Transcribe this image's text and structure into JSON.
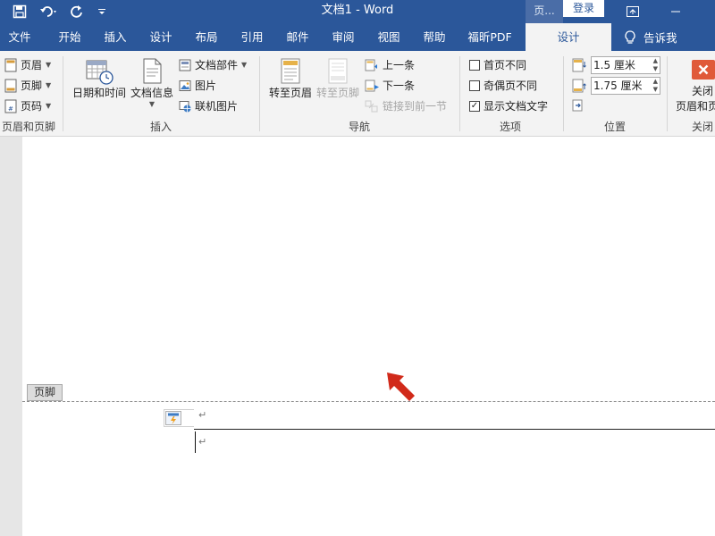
{
  "titlebar": {
    "doc_title": "文档1  -  Word",
    "context_tab_label": "页...",
    "login_label": "登录"
  },
  "tabs": [
    {
      "label": "文件"
    },
    {
      "label": "开始"
    },
    {
      "label": "插入"
    },
    {
      "label": "设计"
    },
    {
      "label": "布局"
    },
    {
      "label": "引用"
    },
    {
      "label": "邮件"
    },
    {
      "label": "审阅"
    },
    {
      "label": "视图"
    },
    {
      "label": "帮助"
    },
    {
      "label": "福昕PDF"
    },
    {
      "label": "设计",
      "active": true
    }
  ],
  "tellme": {
    "label": "告诉我"
  },
  "ribbon": {
    "header_footer": {
      "header": "页眉",
      "footer": "页脚",
      "page_number": "页码",
      "group_label": "页眉和页脚"
    },
    "insert": {
      "date_time": "日期和时间",
      "doc_info": "文档信息",
      "quick_parts": "文档部件",
      "picture": "图片",
      "online_picture": "联机图片",
      "group_label": "插入"
    },
    "navigation": {
      "goto_header": "转至页眉",
      "goto_footer": "转至页脚",
      "previous": "上一条",
      "next": "下一条",
      "link_previous": "链接到前一节",
      "group_label": "导航"
    },
    "options": {
      "different_first": "首页不同",
      "different_odd_even": "奇偶页不同",
      "show_doc_text": "显示文档文字",
      "show_doc_text_checked": true,
      "group_label": "选项"
    },
    "position": {
      "header_from_top": "1.5 厘米",
      "footer_from_bottom": "1.75 厘米",
      "group_label": "位置"
    },
    "close": {
      "label_line1": "关闭",
      "label_line2": "页眉和页",
      "group_label": "关闭"
    }
  },
  "document": {
    "footer_tag": "页脚",
    "para_mark": "↵"
  },
  "colors": {
    "brand_blue": "#2b579a",
    "close_red": "#e05a3a",
    "annotation_arrow": "#d12a1a"
  }
}
